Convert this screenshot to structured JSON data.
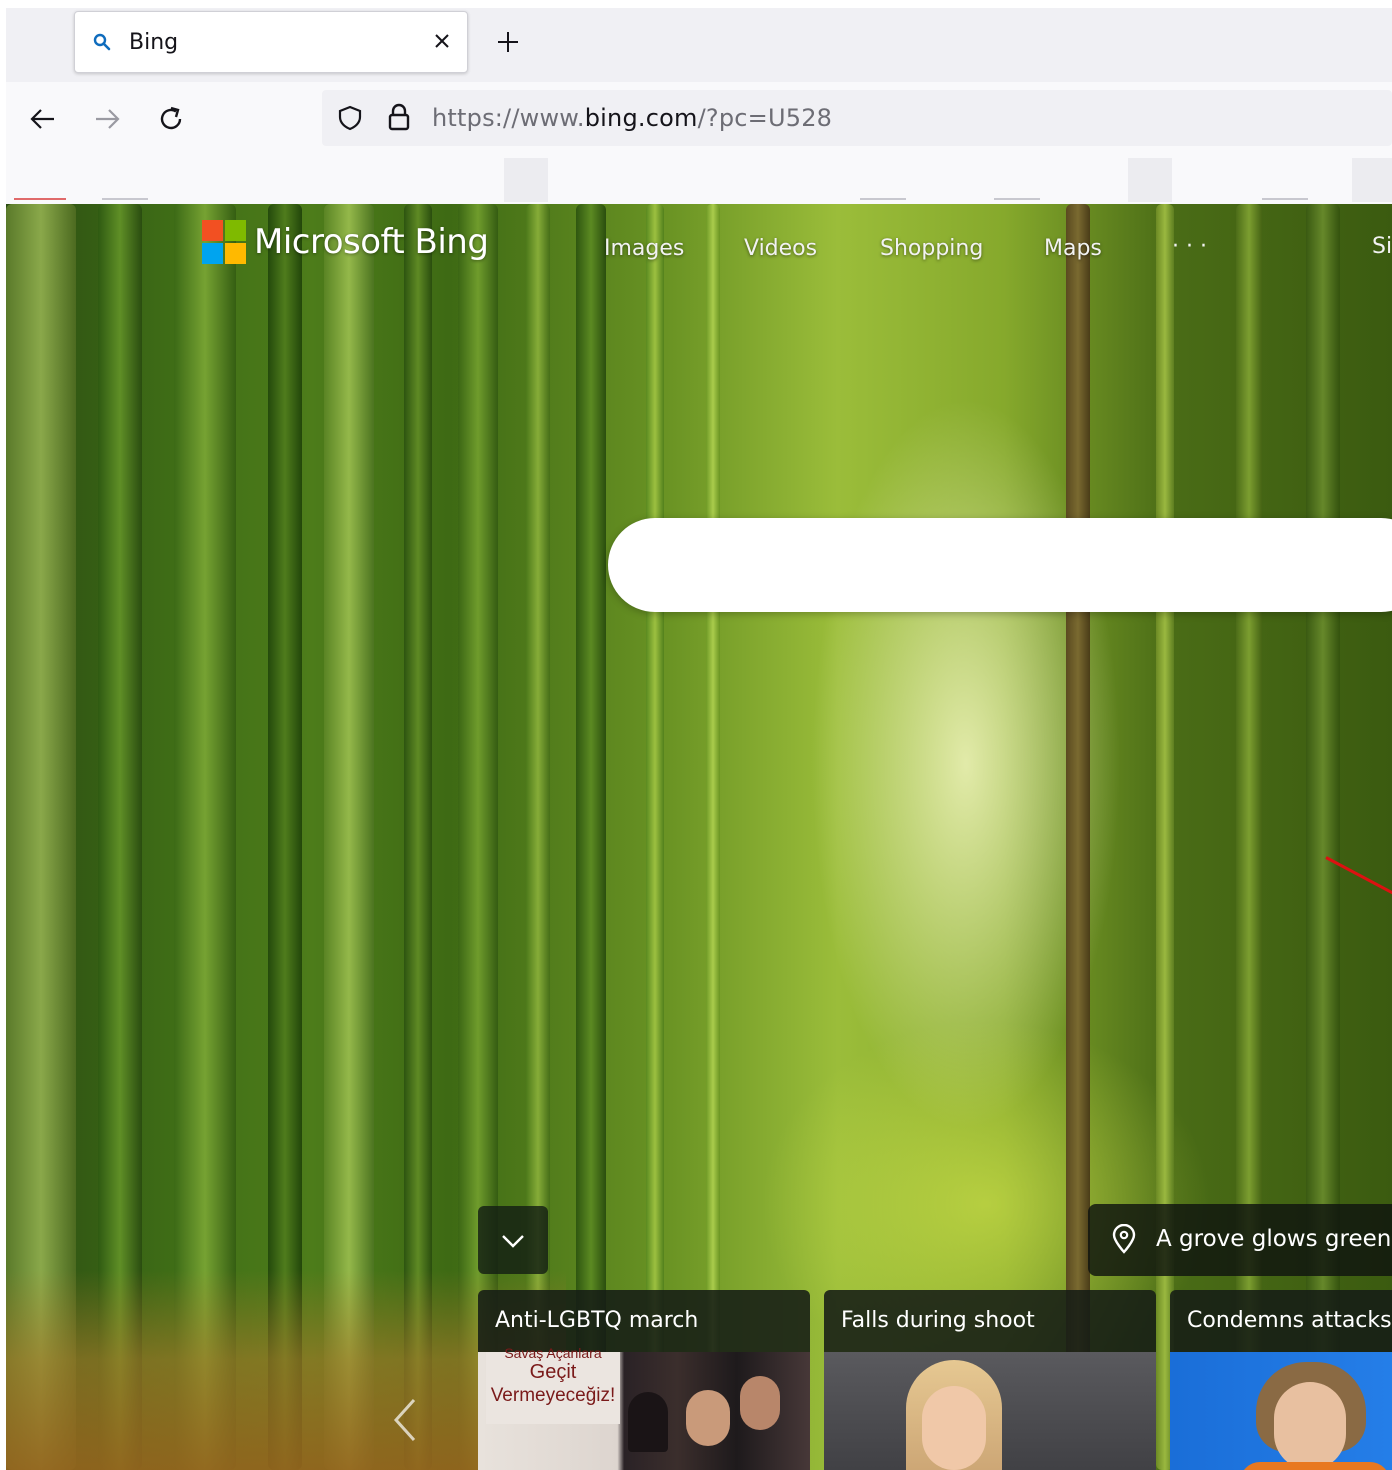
{
  "browser": {
    "tab": {
      "title": "Bing",
      "close_icon": "close-icon",
      "icon": "search-icon"
    },
    "new_tab_icon": "plus-icon",
    "nav": {
      "back_icon": "arrow-left-icon",
      "forward_icon": "arrow-right-icon",
      "reload_icon": "reload-icon"
    },
    "address_bar": {
      "shield_icon": "shield-icon",
      "lock_icon": "lock-icon",
      "url_prefix": "https://www.",
      "url_domain": "bing.com",
      "url_suffix": "/?pc=U528"
    }
  },
  "bing": {
    "logo_text": "Microsoft Bing",
    "logo_colors": [
      "#f25022",
      "#7fba00",
      "#00a4ef",
      "#ffb900"
    ],
    "nav": [
      "Images",
      "Videos",
      "Shopping",
      "Maps"
    ],
    "nav_more": "· · ·",
    "sign_in_partial": "Si",
    "search_placeholder": "",
    "collapse_icon": "chevron-down-icon",
    "image_info": {
      "icon": "location-pin-icon",
      "text": "A grove glows green"
    },
    "news_cards": [
      {
        "title": "Anti-LGBTQ march",
        "thumb_text": [
          "Savaş Açanlara",
          "Geçit",
          "Vermeyeceğiz!"
        ]
      },
      {
        "title": "Falls during shoot"
      },
      {
        "title": "Condemns attacks"
      }
    ],
    "carousel_prev_icon": "chevron-left-icon"
  }
}
